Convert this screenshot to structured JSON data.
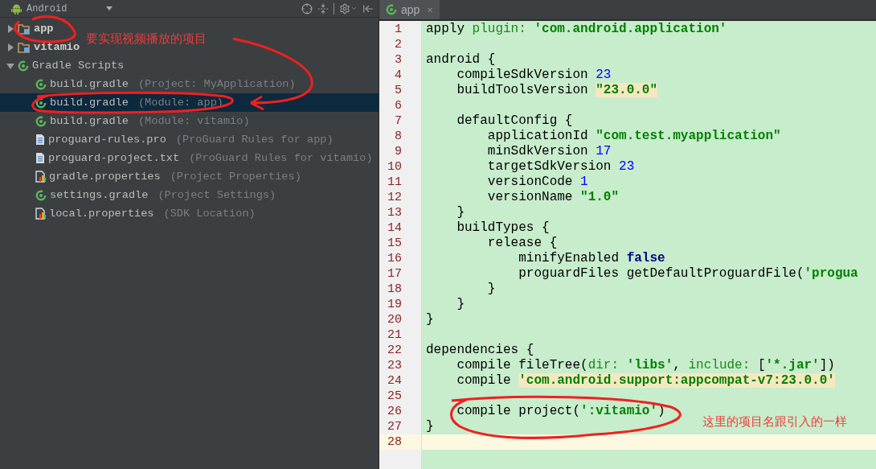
{
  "project_panel": {
    "view_selector": "Android",
    "tree": [
      {
        "name": "app",
        "kind": "module",
        "expanded": false,
        "selected": false
      },
      {
        "name": "vitamio",
        "kind": "module",
        "expanded": false,
        "selected": false
      },
      {
        "name": "Gradle Scripts",
        "kind": "gradle",
        "expanded": true,
        "selected": false,
        "children": [
          {
            "name": "build.gradle",
            "detail": "(Project: MyApplication)",
            "kind": "gradle",
            "selected": false
          },
          {
            "name": "build.gradle",
            "detail": "(Module: app)",
            "kind": "gradle",
            "selected": true
          },
          {
            "name": "build.gradle",
            "detail": "(Module: vitamio)",
            "kind": "gradle",
            "selected": false
          },
          {
            "name": "proguard-rules.pro",
            "detail": "(ProGuard Rules for app)",
            "kind": "text",
            "selected": false
          },
          {
            "name": "proguard-project.txt",
            "detail": "(ProGuard Rules for vitamio)",
            "kind": "text",
            "selected": false
          },
          {
            "name": "gradle.properties",
            "detail": "(Project Properties)",
            "kind": "properties",
            "selected": false
          },
          {
            "name": "settings.gradle",
            "detail": "(Project Settings)",
            "kind": "gradle",
            "selected": false
          },
          {
            "name": "local.properties",
            "detail": "(SDK Location)",
            "kind": "properties",
            "selected": false
          }
        ]
      }
    ]
  },
  "editor": {
    "tabs": [
      {
        "label": "app",
        "close": "×",
        "selected": true
      }
    ],
    "lines": [
      {
        "number": "1",
        "current": false,
        "tokens": [
          {
            "text": "apply ",
            "kind": "plain"
          },
          {
            "text": "plugin: ",
            "kind": "keyword"
          },
          {
            "text": "'com.android.application'",
            "kind": "string"
          }
        ]
      },
      {
        "number": "2",
        "current": false
      },
      {
        "number": "3",
        "current": false,
        "tokens": [
          {
            "text": "android {",
            "kind": "plain"
          }
        ]
      },
      {
        "number": "4",
        "current": false,
        "tokens": [
          {
            "text": "    compileSdkVersion ",
            "kind": "plain"
          },
          {
            "text": "23",
            "kind": "number"
          }
        ]
      },
      {
        "number": "5",
        "current": false,
        "tokens": [
          {
            "text": "    buildToolsVersion ",
            "kind": "plain"
          },
          {
            "text": "\"23.0.0\"",
            "kind": "string_warn"
          }
        ]
      },
      {
        "number": "6",
        "current": false
      },
      {
        "number": "7",
        "current": false,
        "tokens": [
          {
            "text": "    defaultConfig {",
            "kind": "plain"
          }
        ]
      },
      {
        "number": "8",
        "current": false,
        "tokens": [
          {
            "text": "        applicationId ",
            "kind": "plain"
          },
          {
            "text": "\"com.test.myapplication\"",
            "kind": "string"
          }
        ]
      },
      {
        "number": "9",
        "current": false,
        "tokens": [
          {
            "text": "        minSdkVersion ",
            "kind": "plain"
          },
          {
            "text": "17",
            "kind": "number"
          }
        ]
      },
      {
        "number": "10",
        "current": false,
        "tokens": [
          {
            "text": "        targetSdkVersion ",
            "kind": "plain"
          },
          {
            "text": "23",
            "kind": "number"
          }
        ]
      },
      {
        "number": "11",
        "current": false,
        "tokens": [
          {
            "text": "        versionCode ",
            "kind": "plain"
          },
          {
            "text": "1",
            "kind": "number"
          }
        ]
      },
      {
        "number": "12",
        "current": false,
        "tokens": [
          {
            "text": "        versionName ",
            "kind": "plain"
          },
          {
            "text": "\"1.0\"",
            "kind": "string"
          }
        ]
      },
      {
        "number": "13",
        "current": false,
        "tokens": [
          {
            "text": "    }",
            "kind": "plain"
          }
        ]
      },
      {
        "number": "14",
        "current": false,
        "tokens": [
          {
            "text": "    buildTypes {",
            "kind": "plain"
          }
        ]
      },
      {
        "number": "15",
        "current": false,
        "tokens": [
          {
            "text": "        release {",
            "kind": "plain"
          }
        ]
      },
      {
        "number": "16",
        "current": false,
        "tokens": [
          {
            "text": "            minifyEnabled ",
            "kind": "plain"
          },
          {
            "text": "false",
            "kind": "boolean"
          }
        ]
      },
      {
        "number": "17",
        "current": false,
        "tokens": [
          {
            "text": "            proguardFiles getDefaultProguardFile(",
            "kind": "plain"
          },
          {
            "text": "'progua",
            "kind": "string"
          }
        ]
      },
      {
        "number": "18",
        "current": false,
        "tokens": [
          {
            "text": "        }",
            "kind": "plain"
          }
        ]
      },
      {
        "number": "19",
        "current": false,
        "tokens": [
          {
            "text": "    }",
            "kind": "plain"
          }
        ]
      },
      {
        "number": "20",
        "current": false,
        "tokens": [
          {
            "text": "}",
            "kind": "plain"
          }
        ]
      },
      {
        "number": "21",
        "current": false
      },
      {
        "number": "22",
        "current": false,
        "tokens": [
          {
            "text": "dependencies {",
            "kind": "plain"
          }
        ]
      },
      {
        "number": "23",
        "current": false,
        "tokens": [
          {
            "text": "    compile fileTree(",
            "kind": "plain"
          },
          {
            "text": "dir: ",
            "kind": "keyword"
          },
          {
            "text": "'libs'",
            "kind": "string"
          },
          {
            "text": ", ",
            "kind": "plain"
          },
          {
            "text": "include: ",
            "kind": "keyword"
          },
          {
            "text": "[",
            "kind": "plain"
          },
          {
            "text": "'*.jar'",
            "kind": "string"
          },
          {
            "text": "])",
            "kind": "plain"
          }
        ]
      },
      {
        "number": "24",
        "current": false,
        "tokens": [
          {
            "text": "    compile ",
            "kind": "plain"
          },
          {
            "text": "'com.android.support:appcompat-v7:23.0.0'",
            "kind": "string_warn"
          }
        ]
      },
      {
        "number": "25",
        "current": false
      },
      {
        "number": "26",
        "current": false,
        "tokens": [
          {
            "text": "    compile project(",
            "kind": "plain"
          },
          {
            "text": "':vitamio'",
            "kind": "string"
          },
          {
            "text": ")",
            "kind": "plain"
          }
        ]
      },
      {
        "number": "27",
        "current": false,
        "tokens": [
          {
            "text": "}",
            "kind": "plain"
          }
        ]
      },
      {
        "number": "28",
        "current": true
      }
    ]
  },
  "annotations": [
    {
      "text": "要实现视频播放的项目"
    },
    {
      "text": "这里的项目名跟引入的一样"
    }
  ]
}
